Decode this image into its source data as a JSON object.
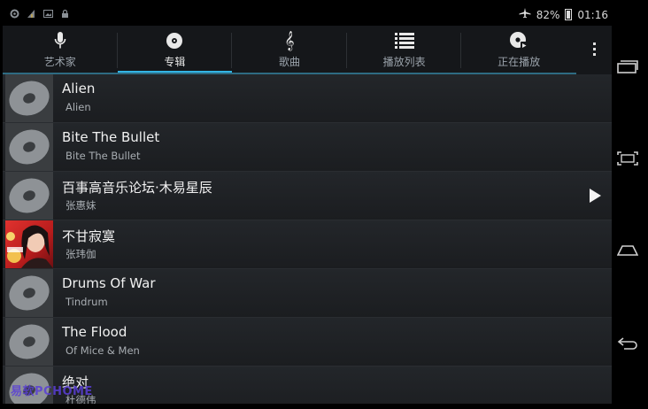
{
  "status_bar": {
    "left_icons": [
      "settings-icon",
      "antenna-icon",
      "image-icon",
      "lock-icon"
    ],
    "airplane_icon": "airplane-icon",
    "battery_percent": "82%",
    "battery_level": 0.82,
    "time": "01:16"
  },
  "tabs": [
    {
      "label": "艺术家",
      "icon": "microphone-icon",
      "active": false
    },
    {
      "label": "专辑",
      "icon": "disc-icon",
      "active": true
    },
    {
      "label": "歌曲",
      "icon": "treble-clef-icon",
      "active": false
    },
    {
      "label": "播放列表",
      "icon": "playlist-icon",
      "active": false
    },
    {
      "label": "正在播放",
      "icon": "now-playing-icon",
      "active": false
    }
  ],
  "albums": [
    {
      "title": "Alien",
      "artist": "Alien",
      "art": "default-disc"
    },
    {
      "title": "Bite The Bullet",
      "artist": "Bite The Bullet",
      "art": "default-disc"
    },
    {
      "title": "百事高音乐论坛·木易星辰",
      "artist": "张惠妹",
      "art": "default-disc",
      "playing": true
    },
    {
      "title": "不甘寂寞",
      "artist": "张玮伽",
      "art": "cover-photo"
    },
    {
      "title": "Drums Of War",
      "artist": "Tindrum",
      "art": "default-disc"
    },
    {
      "title": "The Flood",
      "artist": "Of Mice & Men",
      "art": "default-disc"
    },
    {
      "title": "绝对",
      "artist": "杜德伟",
      "art": "default-disc"
    }
  ],
  "watermark": "易软PCHOME",
  "colors": {
    "accent": "#33b5e5",
    "background": "#1d1f22"
  }
}
